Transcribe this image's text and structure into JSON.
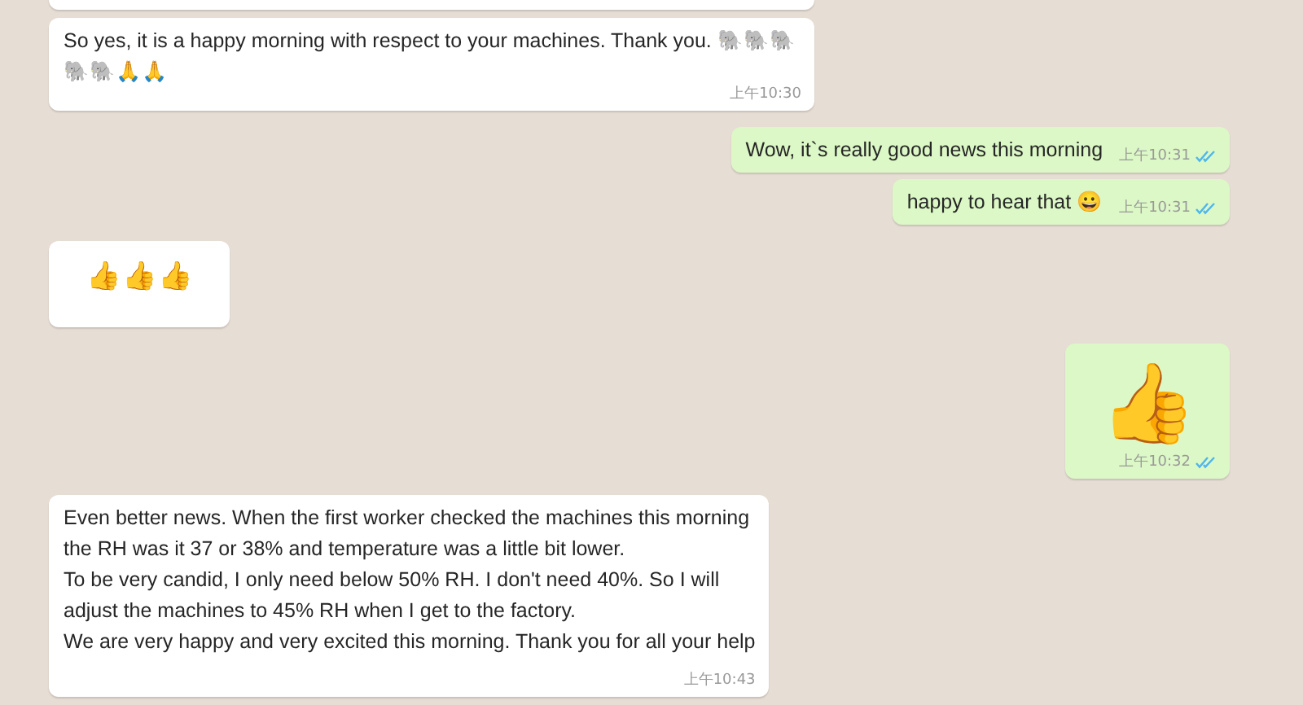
{
  "messages": [
    {
      "kind": "cut",
      "outgoing": false
    },
    {
      "kind": "text",
      "outgoing": false,
      "text": "So yes, it is a happy morning with respect to your machines. Thank you. 🐘🐘🐘🐘🐘🙏🙏",
      "time": "上午10:30"
    },
    {
      "kind": "text",
      "outgoing": true,
      "text": "Wow, it`s really good news this morning",
      "time": "上午10:31",
      "read": true
    },
    {
      "kind": "text",
      "outgoing": true,
      "text": "happy to hear that 😀",
      "time": "上午10:31",
      "read": true
    },
    {
      "kind": "emoji",
      "outgoing": false,
      "text": "👍👍👍"
    },
    {
      "kind": "jumbo",
      "outgoing": true,
      "text": "👍",
      "time": "上午10:32",
      "read": true
    },
    {
      "kind": "text",
      "outgoing": false,
      "text": "Even better news. When the first worker checked the machines this morning\nthe RH was it 37 or 38% and temperature was a little bit lower.\nTo be very candid, I only need below 50% RH. I don't need 40%. So I will\nadjust the machines to 45% RH when I get to the factory.\nWe are very happy and very excited this morning. Thank you for all your help",
      "time": "上午10:43"
    }
  ]
}
